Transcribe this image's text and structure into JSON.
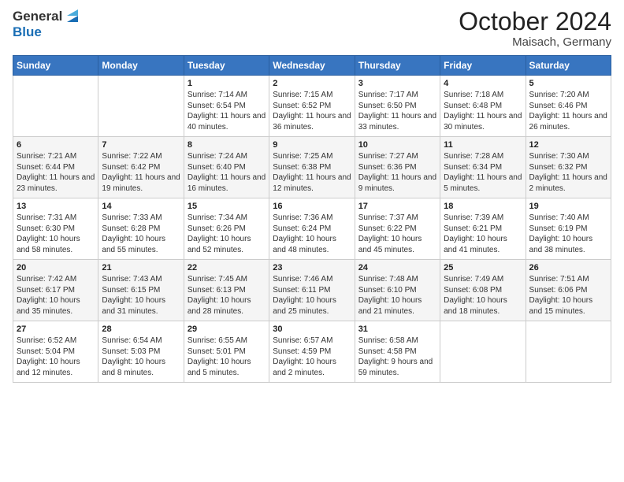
{
  "header": {
    "logo_general": "General",
    "logo_blue": "Blue",
    "title": "October 2024",
    "location": "Maisach, Germany"
  },
  "days_of_week": [
    "Sunday",
    "Monday",
    "Tuesday",
    "Wednesday",
    "Thursday",
    "Friday",
    "Saturday"
  ],
  "weeks": [
    [
      {
        "day": "",
        "sunrise": "",
        "sunset": "",
        "daylight": ""
      },
      {
        "day": "",
        "sunrise": "",
        "sunset": "",
        "daylight": ""
      },
      {
        "day": "1",
        "sunrise": "Sunrise: 7:14 AM",
        "sunset": "Sunset: 6:54 PM",
        "daylight": "Daylight: 11 hours and 40 minutes."
      },
      {
        "day": "2",
        "sunrise": "Sunrise: 7:15 AM",
        "sunset": "Sunset: 6:52 PM",
        "daylight": "Daylight: 11 hours and 36 minutes."
      },
      {
        "day": "3",
        "sunrise": "Sunrise: 7:17 AM",
        "sunset": "Sunset: 6:50 PM",
        "daylight": "Daylight: 11 hours and 33 minutes."
      },
      {
        "day": "4",
        "sunrise": "Sunrise: 7:18 AM",
        "sunset": "Sunset: 6:48 PM",
        "daylight": "Daylight: 11 hours and 30 minutes."
      },
      {
        "day": "5",
        "sunrise": "Sunrise: 7:20 AM",
        "sunset": "Sunset: 6:46 PM",
        "daylight": "Daylight: 11 hours and 26 minutes."
      }
    ],
    [
      {
        "day": "6",
        "sunrise": "Sunrise: 7:21 AM",
        "sunset": "Sunset: 6:44 PM",
        "daylight": "Daylight: 11 hours and 23 minutes."
      },
      {
        "day": "7",
        "sunrise": "Sunrise: 7:22 AM",
        "sunset": "Sunset: 6:42 PM",
        "daylight": "Daylight: 11 hours and 19 minutes."
      },
      {
        "day": "8",
        "sunrise": "Sunrise: 7:24 AM",
        "sunset": "Sunset: 6:40 PM",
        "daylight": "Daylight: 11 hours and 16 minutes."
      },
      {
        "day": "9",
        "sunrise": "Sunrise: 7:25 AM",
        "sunset": "Sunset: 6:38 PM",
        "daylight": "Daylight: 11 hours and 12 minutes."
      },
      {
        "day": "10",
        "sunrise": "Sunrise: 7:27 AM",
        "sunset": "Sunset: 6:36 PM",
        "daylight": "Daylight: 11 hours and 9 minutes."
      },
      {
        "day": "11",
        "sunrise": "Sunrise: 7:28 AM",
        "sunset": "Sunset: 6:34 PM",
        "daylight": "Daylight: 11 hours and 5 minutes."
      },
      {
        "day": "12",
        "sunrise": "Sunrise: 7:30 AM",
        "sunset": "Sunset: 6:32 PM",
        "daylight": "Daylight: 11 hours and 2 minutes."
      }
    ],
    [
      {
        "day": "13",
        "sunrise": "Sunrise: 7:31 AM",
        "sunset": "Sunset: 6:30 PM",
        "daylight": "Daylight: 10 hours and 58 minutes."
      },
      {
        "day": "14",
        "sunrise": "Sunrise: 7:33 AM",
        "sunset": "Sunset: 6:28 PM",
        "daylight": "Daylight: 10 hours and 55 minutes."
      },
      {
        "day": "15",
        "sunrise": "Sunrise: 7:34 AM",
        "sunset": "Sunset: 6:26 PM",
        "daylight": "Daylight: 10 hours and 52 minutes."
      },
      {
        "day": "16",
        "sunrise": "Sunrise: 7:36 AM",
        "sunset": "Sunset: 6:24 PM",
        "daylight": "Daylight: 10 hours and 48 minutes."
      },
      {
        "day": "17",
        "sunrise": "Sunrise: 7:37 AM",
        "sunset": "Sunset: 6:22 PM",
        "daylight": "Daylight: 10 hours and 45 minutes."
      },
      {
        "day": "18",
        "sunrise": "Sunrise: 7:39 AM",
        "sunset": "Sunset: 6:21 PM",
        "daylight": "Daylight: 10 hours and 41 minutes."
      },
      {
        "day": "19",
        "sunrise": "Sunrise: 7:40 AM",
        "sunset": "Sunset: 6:19 PM",
        "daylight": "Daylight: 10 hours and 38 minutes."
      }
    ],
    [
      {
        "day": "20",
        "sunrise": "Sunrise: 7:42 AM",
        "sunset": "Sunset: 6:17 PM",
        "daylight": "Daylight: 10 hours and 35 minutes."
      },
      {
        "day": "21",
        "sunrise": "Sunrise: 7:43 AM",
        "sunset": "Sunset: 6:15 PM",
        "daylight": "Daylight: 10 hours and 31 minutes."
      },
      {
        "day": "22",
        "sunrise": "Sunrise: 7:45 AM",
        "sunset": "Sunset: 6:13 PM",
        "daylight": "Daylight: 10 hours and 28 minutes."
      },
      {
        "day": "23",
        "sunrise": "Sunrise: 7:46 AM",
        "sunset": "Sunset: 6:11 PM",
        "daylight": "Daylight: 10 hours and 25 minutes."
      },
      {
        "day": "24",
        "sunrise": "Sunrise: 7:48 AM",
        "sunset": "Sunset: 6:10 PM",
        "daylight": "Daylight: 10 hours and 21 minutes."
      },
      {
        "day": "25",
        "sunrise": "Sunrise: 7:49 AM",
        "sunset": "Sunset: 6:08 PM",
        "daylight": "Daylight: 10 hours and 18 minutes."
      },
      {
        "day": "26",
        "sunrise": "Sunrise: 7:51 AM",
        "sunset": "Sunset: 6:06 PM",
        "daylight": "Daylight: 10 hours and 15 minutes."
      }
    ],
    [
      {
        "day": "27",
        "sunrise": "Sunrise: 6:52 AM",
        "sunset": "Sunset: 5:04 PM",
        "daylight": "Daylight: 10 hours and 12 minutes."
      },
      {
        "day": "28",
        "sunrise": "Sunrise: 6:54 AM",
        "sunset": "Sunset: 5:03 PM",
        "daylight": "Daylight: 10 hours and 8 minutes."
      },
      {
        "day": "29",
        "sunrise": "Sunrise: 6:55 AM",
        "sunset": "Sunset: 5:01 PM",
        "daylight": "Daylight: 10 hours and 5 minutes."
      },
      {
        "day": "30",
        "sunrise": "Sunrise: 6:57 AM",
        "sunset": "Sunset: 4:59 PM",
        "daylight": "Daylight: 10 hours and 2 minutes."
      },
      {
        "day": "31",
        "sunrise": "Sunrise: 6:58 AM",
        "sunset": "Sunset: 4:58 PM",
        "daylight": "Daylight: 9 hours and 59 minutes."
      },
      {
        "day": "",
        "sunrise": "",
        "sunset": "",
        "daylight": ""
      },
      {
        "day": "",
        "sunrise": "",
        "sunset": "",
        "daylight": ""
      }
    ]
  ]
}
